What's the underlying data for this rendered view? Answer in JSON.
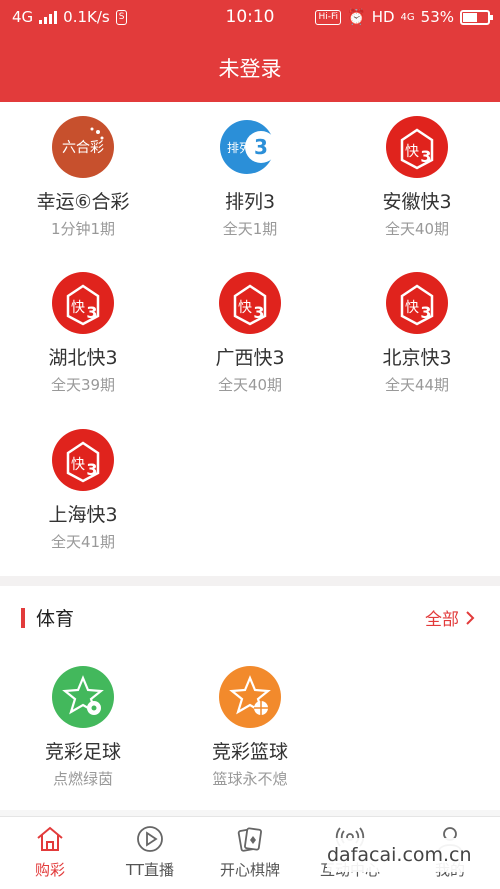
{
  "status_bar": {
    "network": "4G",
    "speed": "0.1K/s",
    "time": "10:10",
    "hifi": "Hi-Fi",
    "hd": "HD",
    "net2": "4G",
    "battery": "53%",
    "battery_level": 0.53
  },
  "header": {
    "title": "未登录"
  },
  "lotteries": [
    {
      "name": "幸运⑥合彩",
      "sub": "1分钟1期",
      "icon": "liuhecai-icon",
      "logo_text": "六合彩"
    },
    {
      "name": "排列3",
      "sub": "全天1期",
      "icon": "pailie3-icon",
      "logo_text": "排列"
    },
    {
      "name": "安徽快3",
      "sub": "全天40期",
      "icon": "kuai3-icon"
    },
    {
      "name": "湖北快3",
      "sub": "全天39期",
      "icon": "kuai3-icon"
    },
    {
      "name": "广西快3",
      "sub": "全天40期",
      "icon": "kuai3-icon"
    },
    {
      "name": "北京快3",
      "sub": "全天44期",
      "icon": "kuai3-icon"
    },
    {
      "name": "上海快3",
      "sub": "全天41期",
      "icon": "kuai3-icon"
    }
  ],
  "sports_section": {
    "title": "体育",
    "more_label": "全部",
    "items": [
      {
        "name": "竞彩足球",
        "sub": "点燃绿茵",
        "icon": "football-icon"
      },
      {
        "name": "竞彩篮球",
        "sub": "篮球永不熄",
        "icon": "basketball-icon"
      }
    ]
  },
  "tabs": [
    {
      "label": "购彩",
      "icon": "home-icon",
      "active": true
    },
    {
      "label": "TT直播",
      "icon": "play-icon",
      "active": false
    },
    {
      "label": "开心棋牌",
      "icon": "cards-icon",
      "active": false
    },
    {
      "label": "互动中心",
      "icon": "broadcast-icon",
      "active": false
    },
    {
      "label": "我的",
      "icon": "user-icon",
      "active": false
    }
  ],
  "watermark": "dafacai.com.cn",
  "colors": {
    "brand_red": "#e23b3b",
    "kuai3_red": "#e0231d",
    "green": "#43b85c",
    "orange": "#f28a2c"
  }
}
